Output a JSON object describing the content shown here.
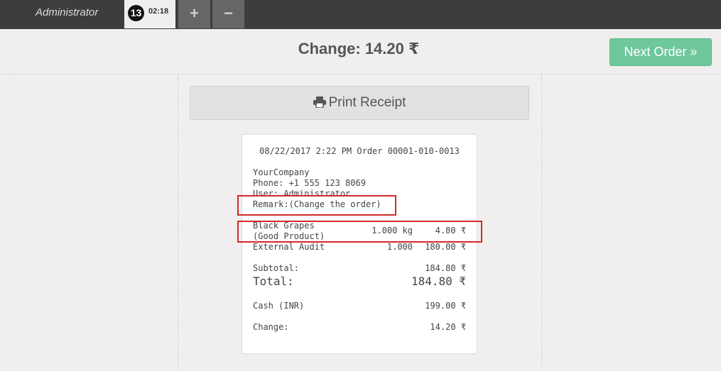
{
  "topbar": {
    "user": "Administrator",
    "order_number": "13",
    "order_time": "02:18",
    "add_label": "+",
    "remove_label": "−"
  },
  "header": {
    "change_title": "Change: 14.20 ₹",
    "next_order_label": "Next Order »"
  },
  "print_receipt_label": "Print Receipt",
  "receipt": {
    "header_line": "08/22/2017 2:22 PM Order 00001-010-0013",
    "company": "YourCompany",
    "phone": "Phone: +1 555 123 8069",
    "user": "User: Administrator",
    "remark": "Remark:(Change the order)",
    "lines": [
      {
        "name": "Black Grapes",
        "note": "(Good Product)",
        "qty": "1.000 kg",
        "price": "4.80 ₹"
      },
      {
        "name": "External Audit",
        "qty": "1.000",
        "price": "180.00 ₹"
      }
    ],
    "subtotal_label": "Subtotal:",
    "subtotal_value": "184.80 ₹",
    "total_label": "Total:",
    "total_value": "184.80 ₹",
    "payment_label": "Cash (INR)",
    "payment_value": "199.00 ₹",
    "change_label": "Change:",
    "change_value": "14.20 ₹"
  },
  "highlight_color": "#d62828",
  "accent_color": "#6ec89b"
}
